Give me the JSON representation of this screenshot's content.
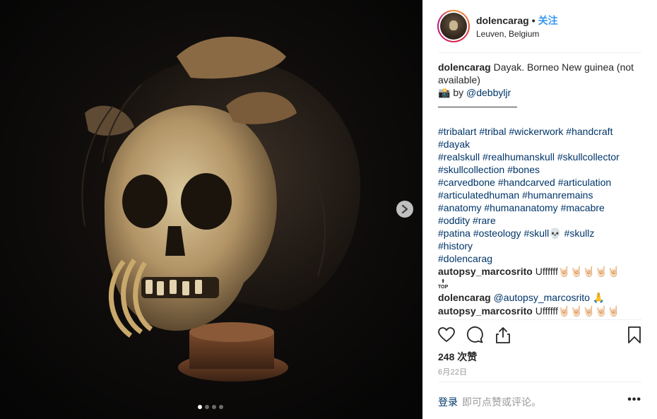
{
  "post": {
    "username": "dolencarag",
    "bullet": "•",
    "follow_label": "关注",
    "location": "Leuven, Belgium"
  },
  "media": {
    "next_icon": "chevron-right-icon",
    "carousel_dots": 4,
    "active_dot": 0
  },
  "caption": {
    "author": "dolencarag",
    "text": "Dayak. Borneo New guinea (not available)",
    "camera_emoji": "📸",
    "by_label": "by",
    "mention": "@debbyljr",
    "separator": "————————",
    "hashtags": [
      [
        "#tribalart",
        "#tribal",
        "#wickerwork",
        "#handcraft"
      ],
      [
        "#dayak"
      ],
      [
        "#realskull",
        "#realhumanskull",
        "#skullcollector"
      ],
      [
        "#skullcollection",
        "#bones"
      ],
      [
        "#carvedbone",
        "#handcarved",
        "#articulation"
      ],
      [
        "#articulatedhuman",
        "#humanremains"
      ],
      [
        "#anatomy",
        "#humananatomy",
        "#macabre"
      ],
      [
        "#oddity",
        "#rare"
      ],
      [
        "#patina",
        "#osteology",
        "#skull💀",
        "#skullz"
      ],
      [
        "#history"
      ],
      [
        "#dolencarag"
      ]
    ]
  },
  "comments": [
    {
      "author": "autopsy_marcosrito",
      "text": "Uffffff",
      "emoji": "🤘🏻🤘🏻🤘🏻🤘🏻🤘🏻",
      "extra": "TOP"
    },
    {
      "author": "dolencarag",
      "mention": "@autopsy_marcosrito",
      "emoji": "🙏"
    },
    {
      "author": "autopsy_marcosrito",
      "text": "Uffffff",
      "emoji": "🤘🏻🤘🏻🤘🏻🤘🏻🤘🏻"
    }
  ],
  "actions": {
    "like_icon": "heart-icon",
    "comment_icon": "comment-icon",
    "share_icon": "share-icon",
    "save_icon": "bookmark-icon"
  },
  "likes": "248 次赞",
  "date": "6月22日",
  "add_comment": {
    "login_label": "登录",
    "placeholder": "即可点赞或评论。",
    "more_label": "•••"
  },
  "colors": {
    "link": "#003569",
    "follow": "#3897f0",
    "muted": "#999999",
    "border": "#efefef"
  }
}
